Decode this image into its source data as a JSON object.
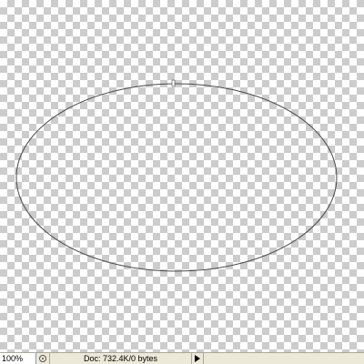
{
  "status_bar": {
    "zoom_value": "100%",
    "doc_info": "Doc: 732.4K/0 bytes",
    "status_icon": "ruler-gear-icon",
    "menu_arrow_icon": "triangle-right-icon"
  },
  "canvas": {
    "checker_light": "#ffffff",
    "checker_dark": "#cccccc",
    "path_color": "#4a4a4a"
  }
}
